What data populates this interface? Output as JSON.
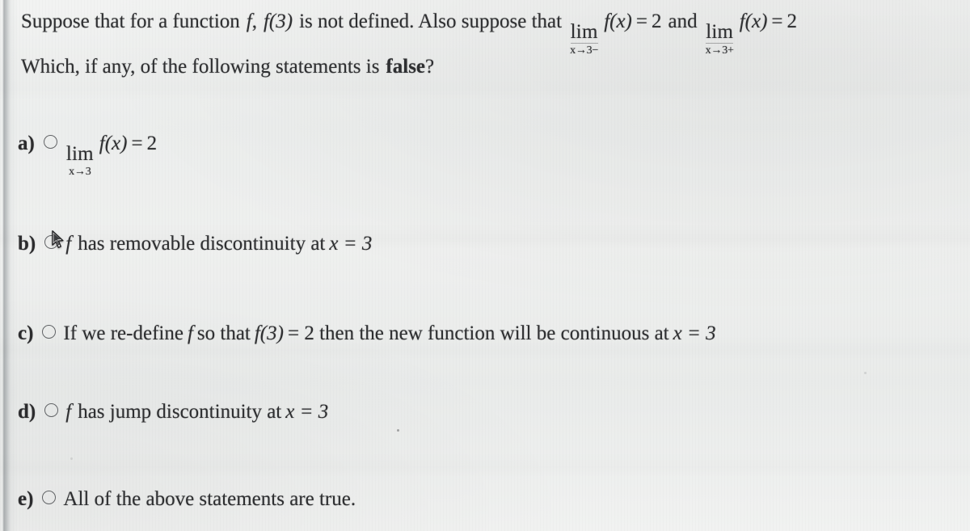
{
  "document": {
    "type": "multiple-choice-question",
    "subject": "calculus-limits-continuity"
  },
  "prompt": {
    "line1": {
      "part1": "Suppose that for a function",
      "f1": "f",
      "comma": ",",
      "f_of_3": "f(3)",
      "part2": "is not defined. Also suppose that",
      "limit1": {
        "operator": "lim",
        "subscript": "x→3−",
        "expression": "f(x)",
        "equals": "=",
        "value": "2"
      },
      "conjunction": "and",
      "limit2": {
        "operator": "lim",
        "subscript": "x→3+",
        "expression": "f(x)",
        "equals": "=",
        "value": "2"
      }
    },
    "line2": {
      "text_before": "Which, if any, of the following statements is",
      "emphasis": "false",
      "text_after": "?"
    }
  },
  "options": [
    {
      "tag": "a)",
      "selected": false,
      "kind": "limit-expression",
      "limit": {
        "operator": "lim",
        "subscript": "x→3",
        "expression": "f(x)",
        "equals": "=",
        "value": "2"
      }
    },
    {
      "tag": "b)",
      "selected": false,
      "kind": "text",
      "func": "f",
      "text": "has removable discontinuity at",
      "math": "x = 3",
      "cursor_over_radio": true
    },
    {
      "tag": "c)",
      "selected": false,
      "kind": "text",
      "text_a": "If we re-define",
      "func": "f",
      "text_b": "so that",
      "func2": "f(3)",
      "text_c": "= 2 then the new function will be continuous at",
      "math": "x = 3"
    },
    {
      "tag": "d)",
      "selected": false,
      "kind": "text",
      "func": "f",
      "text": "has jump discontinuity at",
      "math": "x = 3"
    },
    {
      "tag": "e)",
      "selected": false,
      "kind": "text",
      "text": "All of the above statements are true."
    }
  ],
  "colors": {
    "paper": "#eef0ef",
    "ink": "#2e2f31",
    "page_edge": "#7d8386",
    "radio_outline": "#56585b"
  },
  "cursor": {
    "name": "mouse-pointer",
    "over_option": "b)"
  }
}
